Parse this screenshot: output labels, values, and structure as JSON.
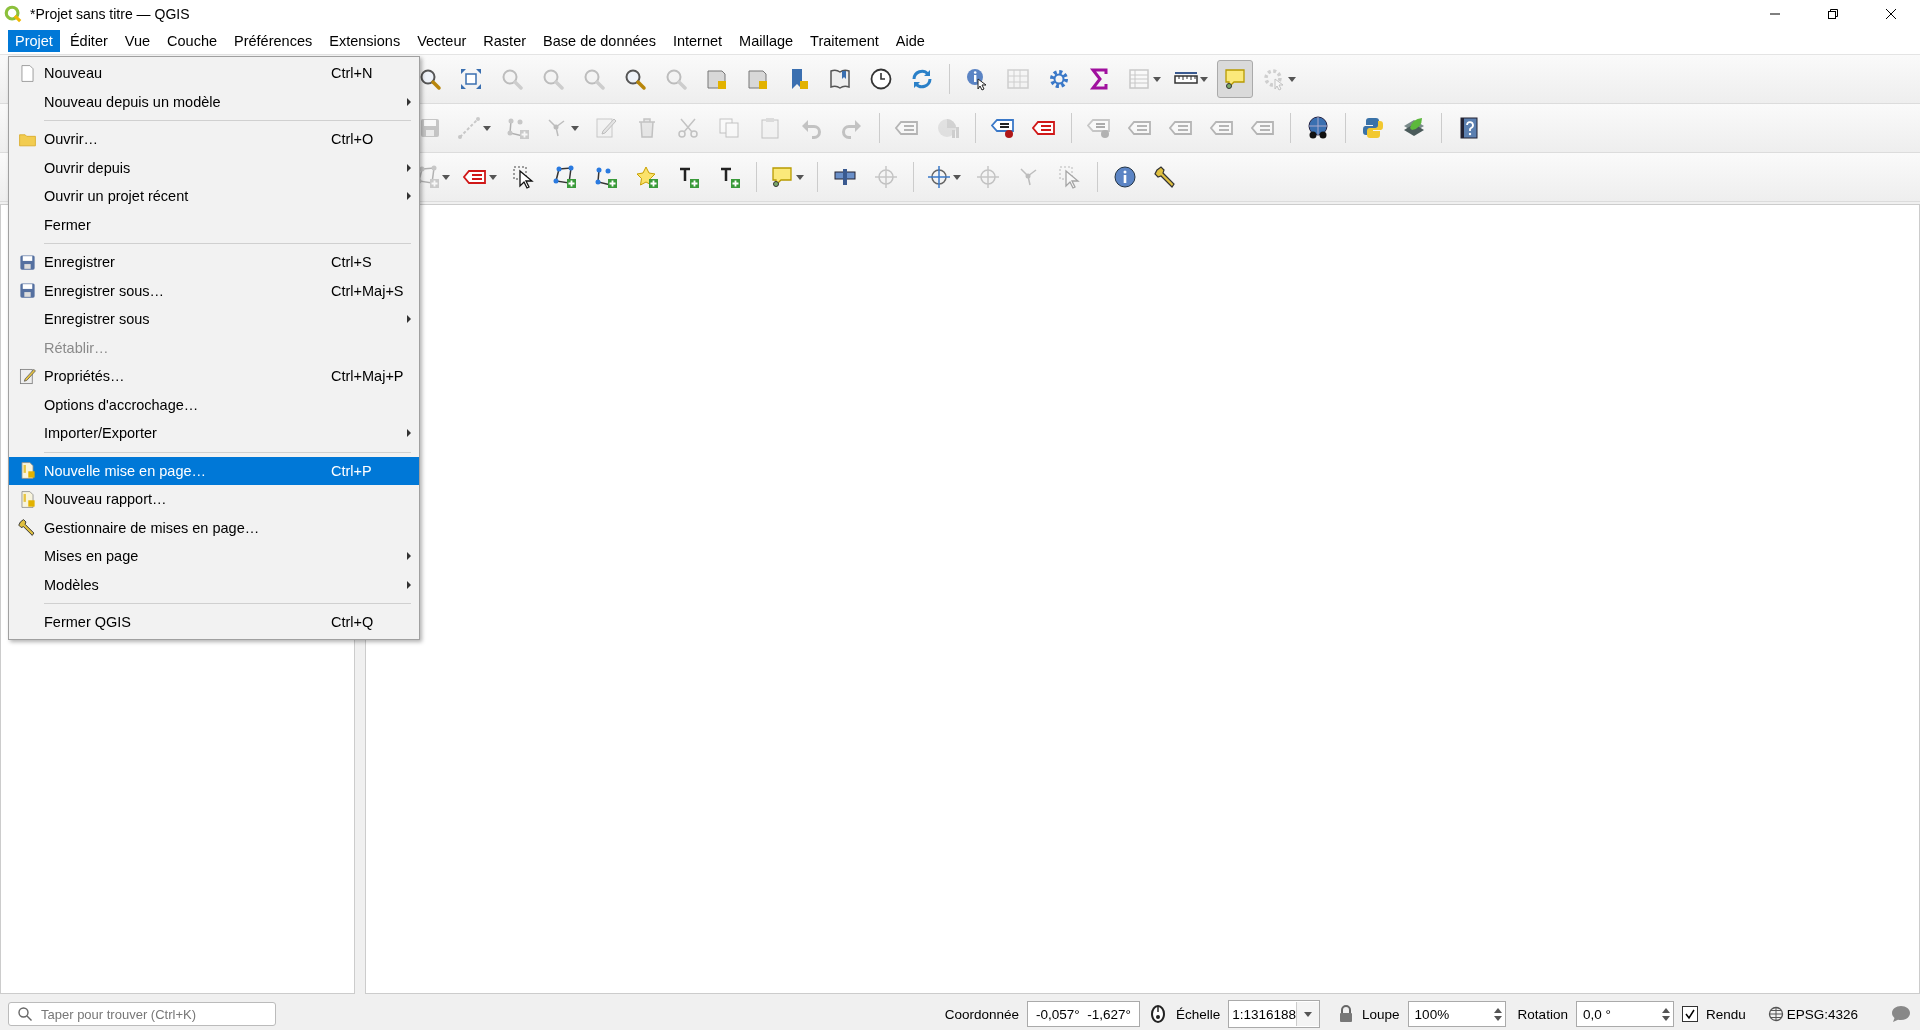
{
  "window": {
    "title": "*Projet sans titre — QGIS"
  },
  "menubar": [
    {
      "label": "Projet",
      "selected": true
    },
    {
      "label": "Éditer",
      "selected": false
    },
    {
      "label": "Vue",
      "selected": false
    },
    {
      "label": "Couche",
      "selected": false
    },
    {
      "label": "Préférences",
      "selected": false
    },
    {
      "label": "Extensions",
      "selected": false
    },
    {
      "label": "Vecteur",
      "selected": false
    },
    {
      "label": "Raster",
      "selected": false
    },
    {
      "label": "Base de données",
      "selected": false
    },
    {
      "label": "Internet",
      "selected": false
    },
    {
      "label": "Maillage",
      "selected": false
    },
    {
      "label": "Traitement",
      "selected": false
    },
    {
      "label": "Aide",
      "selected": false
    }
  ],
  "toolbars": [
    {
      "buttons": [
        {
          "kind": "magnifier",
          "disabled": false,
          "pressed": false,
          "dropdown": false
        },
        {
          "kind": "extent-arrows",
          "disabled": false,
          "pressed": false,
          "dropdown": false
        },
        {
          "kind": "magnifier",
          "disabled": true,
          "pressed": false,
          "dropdown": false
        },
        {
          "kind": "magnifier",
          "disabled": true,
          "pressed": false,
          "dropdown": false
        },
        {
          "kind": "magnifier",
          "disabled": true,
          "pressed": false,
          "dropdown": false
        },
        {
          "kind": "magnifier",
          "disabled": false,
          "pressed": false,
          "dropdown": false
        },
        {
          "kind": "magnifier",
          "disabled": true,
          "pressed": false,
          "dropdown": false
        },
        {
          "kind": "map-sheet",
          "disabled": false,
          "pressed": false,
          "dropdown": false
        },
        {
          "kind": "map-sheet",
          "disabled": false,
          "pressed": false,
          "dropdown": false
        },
        {
          "kind": "bookmark",
          "disabled": false,
          "pressed": false,
          "dropdown": false
        },
        {
          "kind": "book",
          "disabled": false,
          "pressed": false,
          "dropdown": false
        },
        {
          "kind": "clock",
          "disabled": false,
          "pressed": false,
          "dropdown": false
        },
        {
          "kind": "refresh-arrows",
          "disabled": false,
          "pressed": false,
          "dropdown": false
        },
        {
          "kind": "separator"
        },
        {
          "kind": "info-cursor",
          "disabled": false,
          "pressed": false,
          "dropdown": false
        },
        {
          "kind": "abacus",
          "disabled": true,
          "pressed": false,
          "dropdown": false
        },
        {
          "kind": "gear",
          "disabled": false,
          "pressed": false,
          "dropdown": false
        },
        {
          "kind": "sigma",
          "disabled": false,
          "pressed": false,
          "dropdown": false
        },
        {
          "kind": "table",
          "disabled": true,
          "pressed": false,
          "dropdown": true
        },
        {
          "kind": "ruler",
          "disabled": false,
          "pressed": false,
          "dropdown": true
        },
        {
          "kind": "speech-bubble",
          "disabled": false,
          "pressed": true,
          "dropdown": false
        },
        {
          "kind": "gear-cursor",
          "disabled": true,
          "pressed": false,
          "dropdown": true
        }
      ]
    },
    {
      "buttons": [
        {
          "kind": "floppy-disk",
          "disabled": true,
          "pressed": false,
          "dropdown": false
        },
        {
          "kind": "dashed-line",
          "disabled": true,
          "pressed": false,
          "dropdown": true
        },
        {
          "kind": "nodes",
          "disabled": true,
          "pressed": false,
          "dropdown": false
        },
        {
          "kind": "vertex",
          "disabled": true,
          "pressed": false,
          "dropdown": true
        },
        {
          "kind": "pencil",
          "disabled": true,
          "pressed": false,
          "dropdown": false
        },
        {
          "kind": "trash",
          "disabled": true,
          "pressed": false,
          "dropdown": false
        },
        {
          "kind": "scissors",
          "disabled": true,
          "pressed": false,
          "dropdown": false
        },
        {
          "kind": "copy",
          "disabled": true,
          "pressed": false,
          "dropdown": false
        },
        {
          "kind": "clipboard",
          "disabled": true,
          "pressed": false,
          "dropdown": false
        },
        {
          "kind": "undo",
          "disabled": true,
          "pressed": false,
          "dropdown": false
        },
        {
          "kind": "redo",
          "disabled": true,
          "pressed": false,
          "dropdown": false
        },
        {
          "kind": "separator"
        },
        {
          "kind": "label-tag",
          "disabled": true,
          "pressed": false,
          "dropdown": false
        },
        {
          "kind": "pie-chart",
          "disabled": true,
          "pressed": false,
          "dropdown": false
        },
        {
          "kind": "separator"
        },
        {
          "kind": "label-pin",
          "disabled": false,
          "pressed": false,
          "dropdown": false
        },
        {
          "kind": "label-tag",
          "disabled": false,
          "pressed": false,
          "dropdown": false
        },
        {
          "kind": "separator"
        },
        {
          "kind": "label-pin",
          "disabled": true,
          "pressed": false,
          "dropdown": false
        },
        {
          "kind": "label-tag",
          "disabled": true,
          "pressed": false,
          "dropdown": false
        },
        {
          "kind": "label-tag",
          "disabled": true,
          "pressed": false,
          "dropdown": false
        },
        {
          "kind": "label-tag",
          "disabled": true,
          "pressed": false,
          "dropdown": false
        },
        {
          "kind": "label-tag",
          "disabled": true,
          "pressed": false,
          "dropdown": false
        },
        {
          "kind": "separator"
        },
        {
          "kind": "globe-binoculars",
          "disabled": false,
          "pressed": false,
          "dropdown": false
        },
        {
          "kind": "separator"
        },
        {
          "kind": "python",
          "disabled": false,
          "pressed": false,
          "dropdown": false
        },
        {
          "kind": "leaf",
          "disabled": false,
          "pressed": false,
          "dropdown": false
        },
        {
          "kind": "separator"
        },
        {
          "kind": "help",
          "disabled": false,
          "pressed": false,
          "dropdown": false
        }
      ]
    },
    {
      "buttons": [
        {
          "kind": "polygon",
          "disabled": true,
          "pressed": false,
          "dropdown": true
        },
        {
          "kind": "label-tag",
          "disabled": false,
          "pressed": false,
          "dropdown": true
        },
        {
          "kind": "cursor",
          "disabled": false,
          "pressed": false,
          "dropdown": false
        },
        {
          "kind": "polygon",
          "disabled": false,
          "pressed": false,
          "dropdown": false
        },
        {
          "kind": "nodes",
          "disabled": false,
          "pressed": false,
          "dropdown": false
        },
        {
          "kind": "star",
          "disabled": false,
          "pressed": false,
          "dropdown": false
        },
        {
          "kind": "text-block",
          "disabled": false,
          "pressed": false,
          "dropdown": false
        },
        {
          "kind": "text-block",
          "disabled": false,
          "pressed": false,
          "dropdown": false
        },
        {
          "kind": "separator"
        },
        {
          "kind": "speech-bubble",
          "disabled": false,
          "pressed": false,
          "dropdown": true
        },
        {
          "kind": "separator"
        },
        {
          "kind": "pin",
          "disabled": false,
          "pressed": false,
          "dropdown": false
        },
        {
          "kind": "crosshair",
          "disabled": true,
          "pressed": false,
          "dropdown": false
        },
        {
          "kind": "separator"
        },
        {
          "kind": "crosshair",
          "disabled": false,
          "pressed": false,
          "dropdown": true
        },
        {
          "kind": "crosshair",
          "disabled": true,
          "pressed": false,
          "dropdown": false
        },
        {
          "kind": "vertex",
          "disabled": true,
          "pressed": false,
          "dropdown": false
        },
        {
          "kind": "cursor",
          "disabled": true,
          "pressed": false,
          "dropdown": false
        },
        {
          "kind": "separator"
        },
        {
          "kind": "info",
          "disabled": false,
          "pressed": false,
          "dropdown": false
        },
        {
          "kind": "wrench",
          "disabled": false,
          "pressed": false,
          "dropdown": false
        }
      ]
    }
  ],
  "menu": [
    {
      "kind": "page",
      "label": "Nouveau",
      "shortcut": "Ctrl+N",
      "submenu": false,
      "disabled": false,
      "selected": false
    },
    {
      "kind": "plain",
      "label": "Nouveau depuis un modèle",
      "submenu": true,
      "disabled": false,
      "selected": false
    },
    {
      "kind": "separator"
    },
    {
      "kind": "folder",
      "label": "Ouvrir…",
      "shortcut": "Ctrl+O",
      "submenu": false,
      "disabled": false,
      "selected": false
    },
    {
      "kind": "plain",
      "label": "Ouvrir depuis",
      "submenu": true,
      "disabled": false,
      "selected": false
    },
    {
      "kind": "plain",
      "label": "Ouvrir un projet récent",
      "submenu": true,
      "disabled": false,
      "selected": false
    },
    {
      "kind": "plain",
      "label": "Fermer",
      "submenu": false,
      "disabled": false,
      "selected": false
    },
    {
      "kind": "separator"
    },
    {
      "kind": "floppy-disk",
      "label": "Enregistrer",
      "shortcut": "Ctrl+S",
      "submenu": false,
      "disabled": false,
      "selected": false
    },
    {
      "kind": "floppy-disk",
      "label": "Enregistrer sous…",
      "shortcut": "Ctrl+Maj+S",
      "submenu": false,
      "disabled": false,
      "selected": false
    },
    {
      "kind": "plain",
      "label": "Enregistrer sous",
      "submenu": true,
      "disabled": false,
      "selected": false
    },
    {
      "kind": "plain",
      "label": "Rétablir…",
      "submenu": false,
      "disabled": true,
      "selected": false
    },
    {
      "kind": "pencil",
      "label": "Propriétés…",
      "shortcut": "Ctrl+Maj+P",
      "submenu": false,
      "disabled": false,
      "selected": false
    },
    {
      "kind": "plain",
      "label": "Options d'accrochage…",
      "submenu": false,
      "disabled": false,
      "selected": false
    },
    {
      "kind": "plain",
      "label": "Importer/Exporter",
      "submenu": true,
      "disabled": false,
      "selected": false
    },
    {
      "kind": "separator"
    },
    {
      "kind": "layout",
      "label": "Nouvelle mise en page…",
      "shortcut": "Ctrl+P",
      "submenu": false,
      "disabled": false,
      "selected": true
    },
    {
      "kind": "layout",
      "label": "Nouveau rapport…",
      "submenu": false,
      "disabled": false,
      "selected": false
    },
    {
      "kind": "wrench",
      "label": "Gestionnaire de mises en page…",
      "submenu": false,
      "disabled": false,
      "selected": false
    },
    {
      "kind": "plain",
      "label": "Mises en page",
      "submenu": true,
      "disabled": false,
      "selected": false
    },
    {
      "kind": "plain",
      "label": "Modèles",
      "submenu": true,
      "disabled": false,
      "selected": false
    },
    {
      "kind": "separator"
    },
    {
      "kind": "plain",
      "label": "Fermer QGIS",
      "shortcut": "Ctrl+Q",
      "submenu": false,
      "disabled": false,
      "selected": false
    }
  ],
  "status_bar": {
    "search": {
      "placeholder": "Taper pour trouver (Ctrl+K)"
    },
    "coordinate_label": "Coordonnée",
    "coordinate": "-0,057°  -1,627°",
    "scale_label": "Échelle",
    "scale": "1:1316188",
    "magnifier_label": "Loupe",
    "magnifier": "100%",
    "rotation_label": "Rotation",
    "rotation": "0,0 °",
    "render": {
      "label": "Rendu",
      "checked": true
    },
    "crs": "EPSG:4326"
  }
}
